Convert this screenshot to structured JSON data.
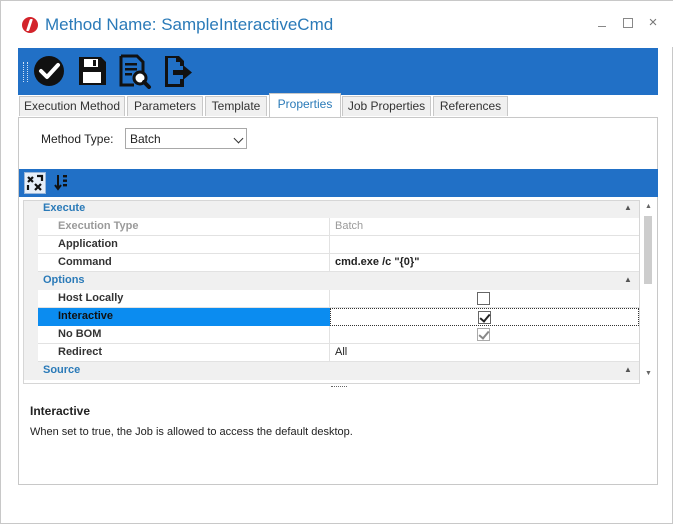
{
  "window": {
    "title": "Method Name: SampleInteractiveCmd",
    "accent_color": "#2170c6",
    "controls": {
      "minimize": "minimize-icon",
      "maximize": "maximize-icon",
      "close": "×"
    }
  },
  "toolbar": {
    "buttons": [
      {
        "icon": "checkmark-circle-icon"
      },
      {
        "icon": "save-disk-icon"
      },
      {
        "icon": "preview-document-icon"
      },
      {
        "icon": "export-arrow-icon"
      }
    ]
  },
  "tabs": [
    {
      "label": "Execution Method",
      "active": false
    },
    {
      "label": "Parameters",
      "active": false
    },
    {
      "label": "Template",
      "active": false
    },
    {
      "label": "Properties",
      "active": true
    },
    {
      "label": "Job Properties",
      "active": false
    },
    {
      "label": "References",
      "active": false
    }
  ],
  "method_type": {
    "label": "Method Type:",
    "value": "Batch"
  },
  "property_grid": {
    "toolbar": [
      {
        "icon": "categorized-icon",
        "pressed": true
      },
      {
        "icon": "sort-alphabetical-icon",
        "pressed": false
      }
    ],
    "categories": [
      {
        "label": "Execute",
        "toggle": "▲",
        "rows": [
          {
            "name": "Execution Type",
            "value": "Batch",
            "dim": true
          },
          {
            "name": "Application",
            "value": ""
          },
          {
            "name": "Command",
            "value": "cmd.exe /c \"{0}\"",
            "bold": true
          }
        ]
      },
      {
        "label": "Options",
        "toggle": "▲",
        "rows": [
          {
            "name": "Host Locally",
            "checkbox": false
          },
          {
            "name": "Interactive",
            "checkbox": true,
            "selected": true
          },
          {
            "name": "No BOM",
            "checkbox": true,
            "disabled": true
          },
          {
            "name": "Redirect",
            "value": "All"
          }
        ]
      },
      {
        "label": "Source",
        "toggle": "▲"
      }
    ]
  },
  "description": {
    "title": "Interactive",
    "text": "When set to true, the Job is allowed to access the default desktop."
  }
}
